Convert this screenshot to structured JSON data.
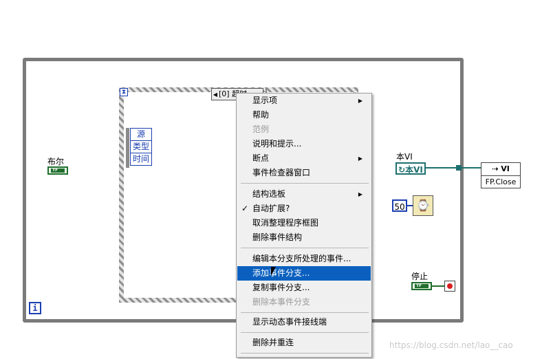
{
  "diagram": {
    "bool_label": "布尔",
    "tf_text": "TF",
    "this_vi_label": "本VI",
    "this_vi_ref": "本VI",
    "fp_close_top": "VI",
    "fp_close_bottom": "FP.Close",
    "const_value": "50",
    "stop_label": "停止",
    "loop_iteration": "i",
    "event_terminals": [
      "源",
      "类型",
      "时间"
    ],
    "case_selector": "[0] 超时"
  },
  "context_menu": {
    "items": [
      {
        "label": "显示项",
        "submenu": true,
        "disabled": false
      },
      {
        "label": "帮助",
        "submenu": false,
        "disabled": false
      },
      {
        "label": "范例",
        "submenu": false,
        "disabled": true
      },
      {
        "label": "说明和提示...",
        "submenu": false,
        "disabled": false
      },
      {
        "label": "断点",
        "submenu": true,
        "disabled": false
      },
      {
        "label": "事件检查器窗口",
        "submenu": false,
        "disabled": false
      },
      {
        "label": "结构选板",
        "submenu": true,
        "disabled": false
      },
      {
        "label": "自动扩展?",
        "submenu": false,
        "disabled": false,
        "checked": true
      },
      {
        "label": "取消整理程序框图",
        "submenu": false,
        "disabled": false
      },
      {
        "label": "删除事件结构",
        "submenu": false,
        "disabled": false
      },
      {
        "label": "编辑本分支所处理的事件...",
        "submenu": false,
        "disabled": false
      },
      {
        "label": "添加事件分支...",
        "submenu": false,
        "disabled": false,
        "highlighted": true
      },
      {
        "label": "复制事件分支...",
        "submenu": false,
        "disabled": false
      },
      {
        "label": "删除本事件分支",
        "submenu": false,
        "disabled": true
      },
      {
        "label": "显示动态事件接线端",
        "submenu": false,
        "disabled": false
      },
      {
        "label": "删除并重连",
        "submenu": false,
        "disabled": false
      }
    ],
    "check_glyph": "✓",
    "submenu_glyph": "▶",
    "highlight_color": "#0b60bf"
  },
  "watermark": "https://blog.csdn.net/lao__cao"
}
